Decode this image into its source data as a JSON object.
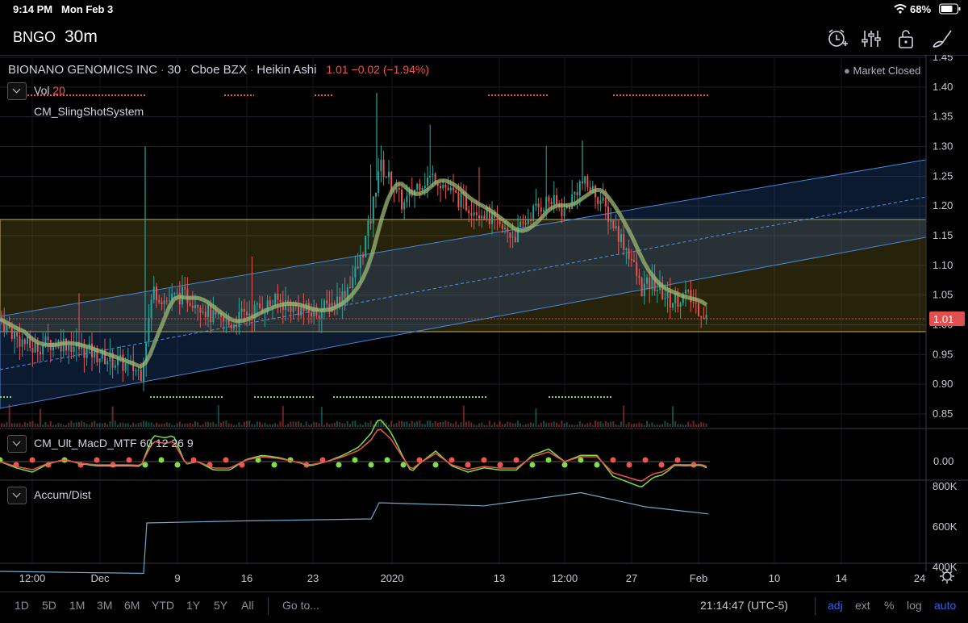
{
  "status_bar": {
    "time": "9:14 PM",
    "date": "Mon Feb 3",
    "battery": "68%"
  },
  "topbar": {
    "symbol": "BNGO",
    "interval": "30m"
  },
  "legend": {
    "name": "BIONANO GENOMICS INC",
    "interval": "30",
    "exchange": "Cboe BZX",
    "style": "Heikin Ashi",
    "sep": "·",
    "price": "1.01",
    "change": "−0.02",
    "change_pct": "(−1.94%)",
    "market_status": "Market Closed"
  },
  "indicators": {
    "vol_name": "Vol",
    "vol_len": "20",
    "slingshot": "CM_SlingShotSystem",
    "macd": "CM_Ult_MacD_MTF",
    "macd_params": "60 12 26 9",
    "accum": "Accum/Dist"
  },
  "bottombar": {
    "ranges": [
      "1D",
      "5D",
      "1M",
      "3M",
      "6M",
      "YTD",
      "1Y",
      "5Y",
      "All"
    ],
    "goto": "Go to...",
    "clock": "21:14:47 (UTC-5)",
    "adj": "adj",
    "ext": "ext",
    "pct": "%",
    "log": "log",
    "auto": "auto"
  },
  "colors": {
    "up": "#26a69a",
    "down": "#ef5350",
    "price_tag": "#e05050",
    "accent": "#2962ff"
  },
  "chart_data": [
    {
      "type": "candlestick",
      "title": "BIONANO GENOMICS INC · 30 · Cboe BZX · Heikin Ashi",
      "x_tick_labels": [
        "12:00",
        "Dec",
        "9",
        "16",
        "23",
        "2020",
        "13",
        "12:00",
        "27",
        "Feb",
        "10",
        "14",
        "24"
      ],
      "y_tick_labels": [
        "0.85",
        "0.90",
        "0.95",
        "1.00",
        "1.05",
        "1.10",
        "1.15",
        "1.20",
        "1.25",
        "1.30",
        "1.35",
        "1.40",
        "1.45"
      ],
      "ylim": [
        0.82,
        1.46
      ],
      "last_price": 1.01,
      "close_series": [
        {
          "t": 0,
          "v": 1.01
        },
        {
          "t": 20,
          "v": 0.98
        },
        {
          "t": 40,
          "v": 0.96
        },
        {
          "t": 60,
          "v": 0.97
        },
        {
          "t": 80,
          "v": 0.97
        },
        {
          "t": 100,
          "v": 0.96
        },
        {
          "t": 120,
          "v": 0.95
        },
        {
          "t": 140,
          "v": 0.94
        },
        {
          "t": 160,
          "v": 0.93
        },
        {
          "t": 175,
          "v": 0.92
        },
        {
          "t": 180,
          "v": 0.97
        },
        {
          "t": 190,
          "v": 1.06
        },
        {
          "t": 205,
          "v": 1.04
        },
        {
          "t": 225,
          "v": 1.05
        },
        {
          "t": 245,
          "v": 1.04
        },
        {
          "t": 265,
          "v": 1.01
        },
        {
          "t": 285,
          "v": 1.0
        },
        {
          "t": 305,
          "v": 1.02
        },
        {
          "t": 325,
          "v": 1.03
        },
        {
          "t": 345,
          "v": 1.04
        },
        {
          "t": 365,
          "v": 1.03
        },
        {
          "t": 385,
          "v": 1.02
        },
        {
          "t": 405,
          "v": 1.03
        },
        {
          "t": 425,
          "v": 1.05
        },
        {
          "t": 445,
          "v": 1.1
        },
        {
          "t": 460,
          "v": 1.18
        },
        {
          "t": 470,
          "v": 1.27
        },
        {
          "t": 480,
          "v": 1.25
        },
        {
          "t": 500,
          "v": 1.2
        },
        {
          "t": 520,
          "v": 1.24
        },
        {
          "t": 540,
          "v": 1.25
        },
        {
          "t": 560,
          "v": 1.22
        },
        {
          "t": 580,
          "v": 1.2
        },
        {
          "t": 600,
          "v": 1.19
        },
        {
          "t": 620,
          "v": 1.16
        },
        {
          "t": 640,
          "v": 1.15
        },
        {
          "t": 660,
          "v": 1.19
        },
        {
          "t": 680,
          "v": 1.21
        },
        {
          "t": 700,
          "v": 1.19
        },
        {
          "t": 720,
          "v": 1.24
        },
        {
          "t": 740,
          "v": 1.22
        },
        {
          "t": 760,
          "v": 1.17
        },
        {
          "t": 780,
          "v": 1.12
        },
        {
          "t": 795,
          "v": 1.06
        },
        {
          "t": 810,
          "v": 1.07
        },
        {
          "t": 830,
          "v": 1.04
        },
        {
          "t": 850,
          "v": 1.05
        },
        {
          "t": 865,
          "v": 1.03
        },
        {
          "t": 878,
          "v": 1.01
        }
      ],
      "accum_dist": {
        "y_tick_labels": [
          "400K",
          "600K",
          "800K"
        ],
        "series": [
          {
            "t": 0,
            "v": 380
          },
          {
            "t": 178,
            "v": 370
          },
          {
            "t": 182,
            "v": 620
          },
          {
            "t": 300,
            "v": 630
          },
          {
            "t": 460,
            "v": 640
          },
          {
            "t": 470,
            "v": 720
          },
          {
            "t": 600,
            "v": 705
          },
          {
            "t": 720,
            "v": 770
          },
          {
            "t": 800,
            "v": 700
          },
          {
            "t": 878,
            "v": 665
          }
        ]
      }
    }
  ]
}
